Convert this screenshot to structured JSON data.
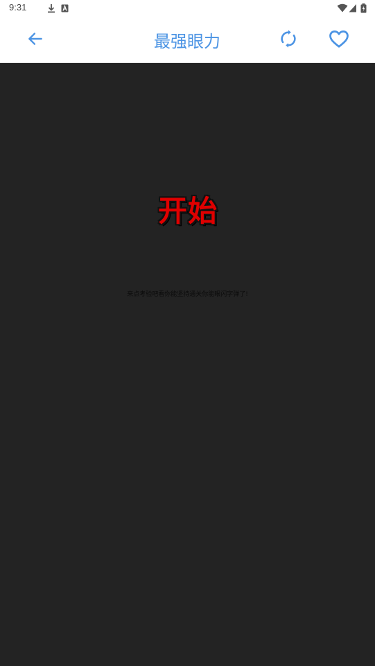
{
  "status_bar": {
    "time": "9:31",
    "icons": [
      "download-icon",
      "a-badge-icon",
      "wifi-icon",
      "signal-icon",
      "battery-icon"
    ]
  },
  "app_bar": {
    "title": "最强眼力",
    "accent_color": "#4c94e4",
    "back_icon": "arrow-left-icon",
    "refresh_icon": "refresh-icon",
    "favorite_icon": "heart-icon"
  },
  "game": {
    "background_color": "#232323",
    "start_label": "开始",
    "start_color": "#e00000",
    "hint": "来点考验吧看你能坚持通关你能眼闪字弹了!"
  }
}
